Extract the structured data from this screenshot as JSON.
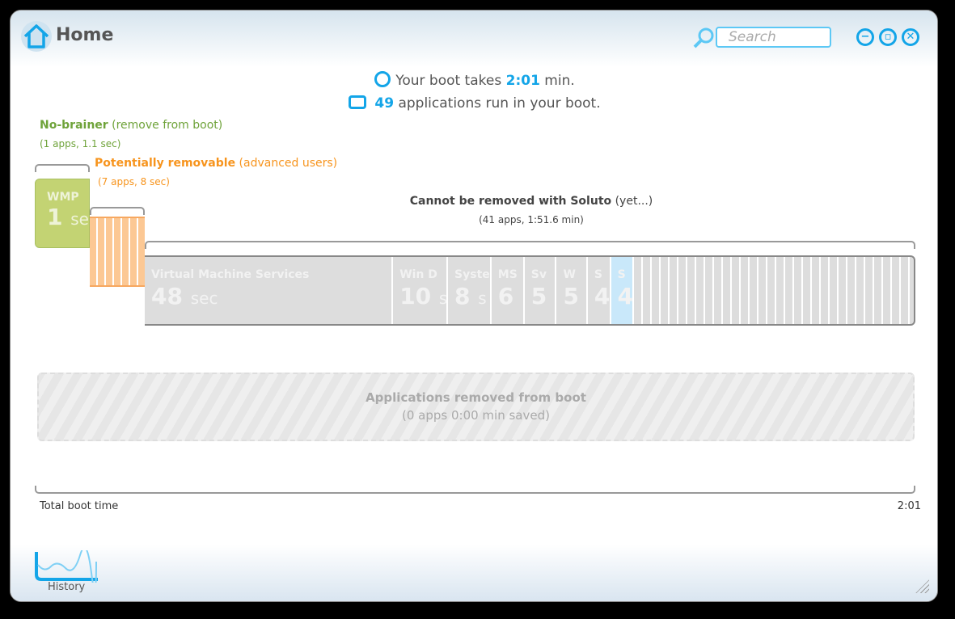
{
  "header": {
    "title": "Home",
    "search_placeholder": "Search"
  },
  "summary": {
    "boot_prefix": "Your boot takes ",
    "boot_time": "2:01",
    "boot_suffix": " min.",
    "apps_count": "49",
    "apps_suffix": " applications run in your boot."
  },
  "no_brainer": {
    "title": "No-brainer",
    "subtitle": " (remove from boot)",
    "detail": "(1 apps, 1.1 sec)",
    "color": "#6fa33a",
    "app": {
      "label": "WMP",
      "value": "1",
      "unit": "sec"
    }
  },
  "potential": {
    "title": "Potentially removable",
    "subtitle": " (advanced users)",
    "detail": "(7 apps, 8 sec)",
    "color": "#f7941d"
  },
  "cannot": {
    "title": "Cannot be removed with Soluto",
    "subtitle": " (yet...)",
    "detail": "(41 apps, 1:51.6 min)",
    "segments": [
      {
        "label": "Virtual Machine Services",
        "value": "48",
        "unit": "sec",
        "seconds": 48
      },
      {
        "label": "Win D",
        "value": "10",
        "unit": "s",
        "seconds": 10.6
      },
      {
        "label": "Syste",
        "value": "8",
        "unit": "s",
        "seconds": 8.4
      },
      {
        "label": "MS",
        "value": "6",
        "unit": "",
        "seconds": 6.4
      },
      {
        "label": "Sv",
        "value": "5",
        "unit": "",
        "seconds": 6.2
      },
      {
        "label": "W",
        "value": "5",
        "unit": "",
        "seconds": 6
      },
      {
        "label": "S",
        "value": "4",
        "unit": "",
        "seconds": 4.5
      },
      {
        "label": "S",
        "value": "4",
        "unit": "",
        "seconds": 4.5,
        "selected": true
      }
    ]
  },
  "removed": {
    "title": "Applications removed from boot",
    "detail": "(0 apps 0:00 min saved)"
  },
  "total": {
    "label": "Total boot time",
    "value": "2:01"
  },
  "footer": {
    "history_label": "History"
  }
}
